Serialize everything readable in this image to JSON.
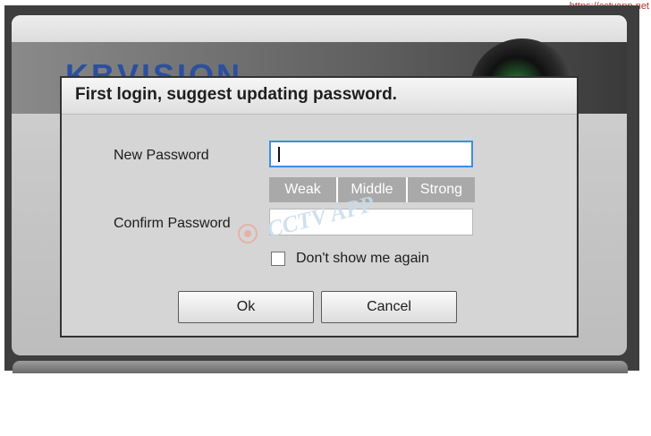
{
  "watermark": {
    "url": "https://cctvapp.net",
    "mark_text": "CCTV APP"
  },
  "background": {
    "logo_text": "KBVISION"
  },
  "dialog": {
    "title": "First login, suggest updating password.",
    "new_password": {
      "label": "New Password",
      "value": ""
    },
    "strength": {
      "levels": [
        "Weak",
        "Middle",
        "Strong"
      ]
    },
    "confirm_password": {
      "label": "Confirm Password",
      "value": ""
    },
    "dont_show": {
      "label": "Don't show me again",
      "checked": false
    },
    "buttons": {
      "ok": "Ok",
      "cancel": "Cancel"
    }
  },
  "colors": {
    "focus_border": "#3a8ee6",
    "strength_inactive": "#a9a9a9",
    "logo_blue": "#2c4f9e",
    "watermark_red": "#b0352e"
  }
}
